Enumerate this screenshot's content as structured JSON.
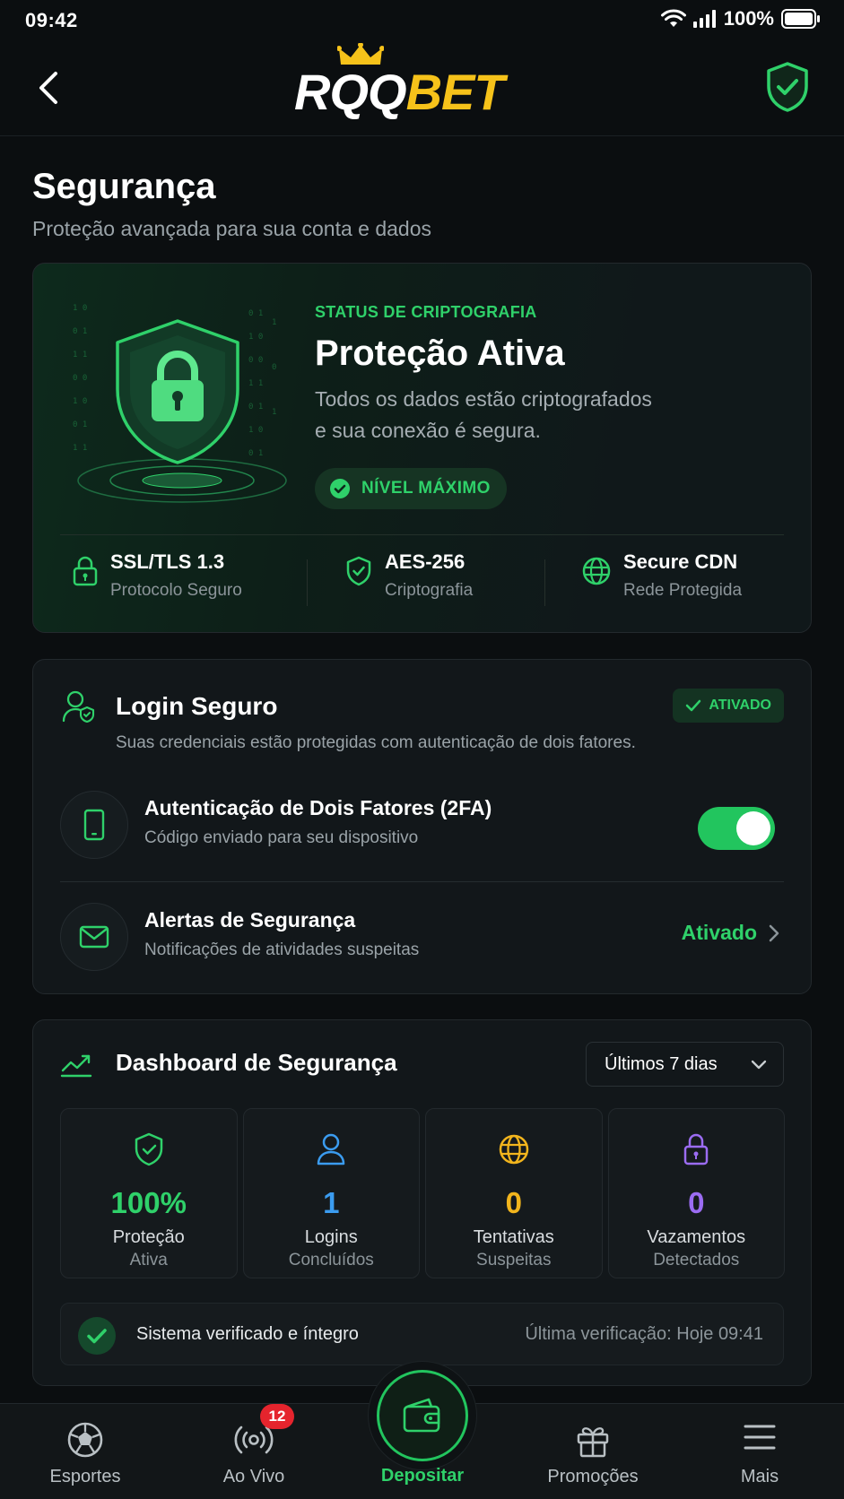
{
  "status_bar": {
    "time": "09:42",
    "battery": "100%"
  },
  "header": {
    "logo_white": "RQQ",
    "logo_yellow": "BET"
  },
  "page": {
    "title": "Segurança",
    "subtitle": "Proteção avançada para sua conta e dados"
  },
  "hero": {
    "kicker": "STATUS DE CRIPTOGRAFIA",
    "title": "Proteção Ativa",
    "desc_line1": "Todos os dados estão criptografados",
    "desc_line2": "e sua conexão é segura.",
    "level": "NÍVEL MÁXIMO",
    "features": [
      {
        "title": "SSL/TLS 1.3",
        "subtitle": "Protocolo Seguro",
        "icon": "lock-icon"
      },
      {
        "title": "AES-256",
        "subtitle": "Criptografia",
        "icon": "shield-check-icon"
      },
      {
        "title": "Secure CDN",
        "subtitle": "Rede Protegida",
        "icon": "globe-icon"
      }
    ]
  },
  "login": {
    "title": "Login Seguro",
    "badge": "ATIVADO",
    "desc": "Suas credenciais estão protegidas com autenticação de dois fatores.",
    "twofa": {
      "title": "Autenticação de Dois Fatores (2FA)",
      "subtitle": "Código enviado para seu dispositivo",
      "enabled": true
    },
    "alerts": {
      "title": "Alertas de Segurança",
      "subtitle": "Notificações de atividades suspeitas",
      "status": "Ativado"
    }
  },
  "dashboard": {
    "title": "Dashboard de Segurança",
    "period": "Últimos 7 dias",
    "stats": [
      {
        "value": "100%",
        "label1": "Proteção",
        "label2": "Ativa",
        "color": "#2fd16a",
        "icon": "shield-check-icon"
      },
      {
        "value": "1",
        "label1": "Logins",
        "label2": "Concluídos",
        "color": "#3b9cf0",
        "icon": "user-icon"
      },
      {
        "value": "0",
        "label1": "Tentativas",
        "label2": "Suspeitas",
        "color": "#f2b51d",
        "icon": "globe-icon"
      },
      {
        "value": "0",
        "label1": "Vazamentos",
        "label2": "Detectados",
        "color": "#9b6cf2",
        "icon": "lock-icon"
      }
    ],
    "verify_text": "Sistema verificado e íntegro",
    "verify_time": "Última verificação: Hoje 09:41"
  },
  "tabbar": {
    "items": [
      {
        "label": "Esportes",
        "icon": "soccer-ball-icon"
      },
      {
        "label": "Ao Vivo",
        "icon": "live-broadcast-icon",
        "badge": "12"
      },
      {
        "label": "Depositar",
        "icon": "wallet-icon"
      },
      {
        "label": "Promoções",
        "icon": "gift-icon"
      },
      {
        "label": "Mais",
        "icon": "menu-icon"
      }
    ]
  },
  "colors": {
    "accent": "#22c55e",
    "brand_yellow": "#f6c21a",
    "background": "#0b0e10"
  }
}
